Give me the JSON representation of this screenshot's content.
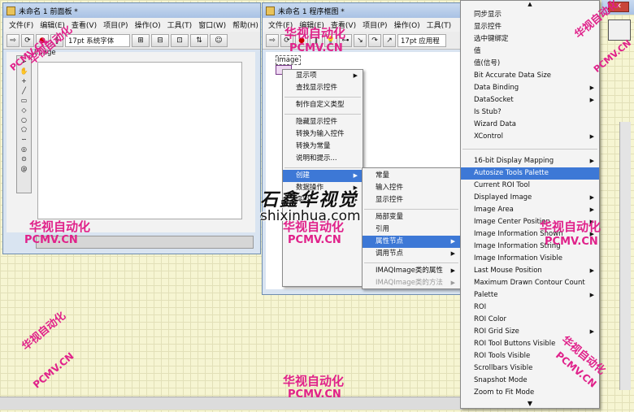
{
  "front_panel": {
    "title": "未命名 1 前面板 *",
    "menu": [
      "文件(F)",
      "编辑(E)",
      "查看(V)",
      "项目(P)",
      "操作(O)",
      "工具(T)",
      "窗口(W)",
      "帮助(H)"
    ],
    "font": "17pt 系统字体",
    "control_label": "Image"
  },
  "block_diagram": {
    "title": "未命名 1 程序框图 *",
    "menu": [
      "文件(F)",
      "编辑(E)",
      "查看(V)",
      "项目(P)",
      "操作(O)",
      "工具(T)"
    ],
    "font": "17pt 应用程",
    "terminal_label": "Image"
  },
  "context_menu": {
    "items": [
      {
        "label": "显示项",
        "submenu": true
      },
      {
        "label": "查找显示控件",
        "submenu": false
      },
      {
        "label": "制作自定义类型",
        "submenu": false
      },
      {
        "label": "隐藏显示控件",
        "submenu": false
      },
      {
        "label": "转换为输入控件",
        "submenu": false
      },
      {
        "label": "转换为常量",
        "submenu": false
      },
      {
        "label": "说明和提示...",
        "submenu": false
      },
      {
        "label": "创建",
        "submenu": true
      },
      {
        "label": "数据操作",
        "submenu": true
      },
      {
        "label": "高级",
        "submenu": true
      }
    ]
  },
  "create_menu": {
    "items": [
      {
        "label": "常量",
        "submenu": false
      },
      {
        "label": "输入控件",
        "submenu": false
      },
      {
        "label": "显示控件",
        "submenu": false
      },
      {
        "label": "局部变量",
        "submenu": false
      },
      {
        "label": "引用",
        "submenu": false
      },
      {
        "label": "属性节点",
        "submenu": true
      },
      {
        "label": "调用节点",
        "submenu": true
      },
      {
        "label": "IMAQImage类的属性",
        "submenu": true
      },
      {
        "label": "IMAQImage类的方法",
        "submenu": true
      }
    ]
  },
  "property_menu": {
    "items": [
      {
        "label": "同步显示",
        "submenu": false
      },
      {
        "label": "显示控件",
        "submenu": false
      },
      {
        "label": "选中键绑定",
        "submenu": false
      },
      {
        "label": "值",
        "submenu": false
      },
      {
        "label": "值(信号)",
        "submenu": false
      },
      {
        "label": "Bit Accurate Data Size",
        "submenu": false
      },
      {
        "label": "Data Binding",
        "submenu": true
      },
      {
        "label": "DataSocket",
        "submenu": true
      },
      {
        "label": "Is Stub?",
        "submenu": false
      },
      {
        "label": "Wizard Data",
        "submenu": false
      },
      {
        "label": "XControl",
        "submenu": true
      },
      {
        "label": "16-bit Display Mapping",
        "submenu": true
      },
      {
        "label": "Autosize Tools Palette",
        "submenu": false
      },
      {
        "label": "Current ROI Tool",
        "submenu": false
      },
      {
        "label": "Displayed Image",
        "submenu": true
      },
      {
        "label": "Image Area",
        "submenu": true
      },
      {
        "label": "Image Center Position",
        "submenu": true
      },
      {
        "label": "Image Information Shown",
        "submenu": true
      },
      {
        "label": "Image Information String",
        "submenu": false
      },
      {
        "label": "Image Information Visible",
        "submenu": false
      },
      {
        "label": "Last Mouse Position",
        "submenu": true
      },
      {
        "label": "Maximum Drawn Contour Count",
        "submenu": false
      },
      {
        "label": "Palette",
        "submenu": true
      },
      {
        "label": "ROI",
        "submenu": false
      },
      {
        "label": "ROI Color",
        "submenu": false
      },
      {
        "label": "ROI Grid Size",
        "submenu": true
      },
      {
        "label": "ROI Tool Buttons Visible",
        "submenu": false
      },
      {
        "label": "ROI Tools Visible",
        "submenu": false
      },
      {
        "label": "Scrollbars Visible",
        "submenu": false
      },
      {
        "label": "Snapshot Mode",
        "submenu": false
      },
      {
        "label": "Zoom to Fit Mode",
        "submenu": false
      }
    ]
  },
  "watermarks": {
    "cn": "华视自动化",
    "en": "PCMV.CN",
    "brand_cn": "石鑫华视觉",
    "brand_url": "shixinhua.com"
  },
  "colors": {
    "highlight": "#3d78d6",
    "watermark": "#e0218a",
    "desktop": "#f6f5d2"
  }
}
